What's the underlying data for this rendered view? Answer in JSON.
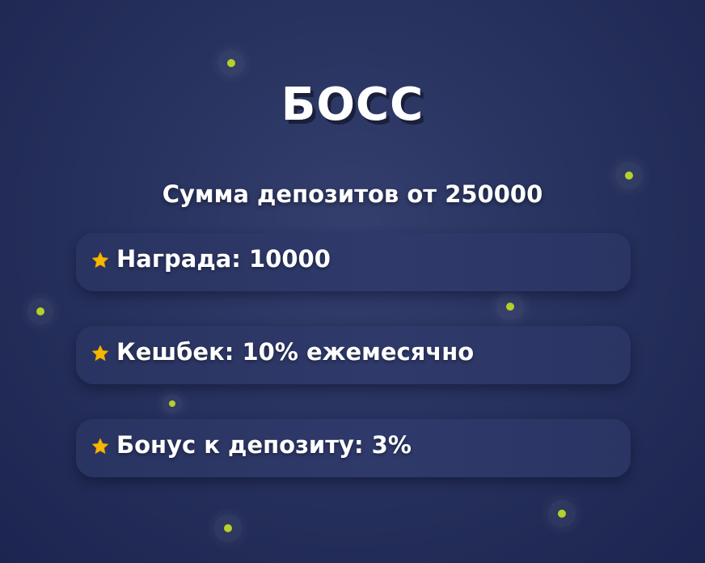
{
  "title": "БОСС",
  "subtitle": "Сумма депозитов от 250000",
  "benefits": [
    {
      "label": "Награда: 10000",
      "icon": "star-icon"
    },
    {
      "label": "Кешбек: 10% ежемесячно",
      "icon": "star-icon"
    },
    {
      "label": "Бонус к депозиту: 3%",
      "icon": "star-icon"
    }
  ],
  "colors": {
    "background": "#27305c",
    "card": "#2d3868",
    "star": "#f5b800",
    "dots": "#b5d12a",
    "text": "#ffffff"
  }
}
